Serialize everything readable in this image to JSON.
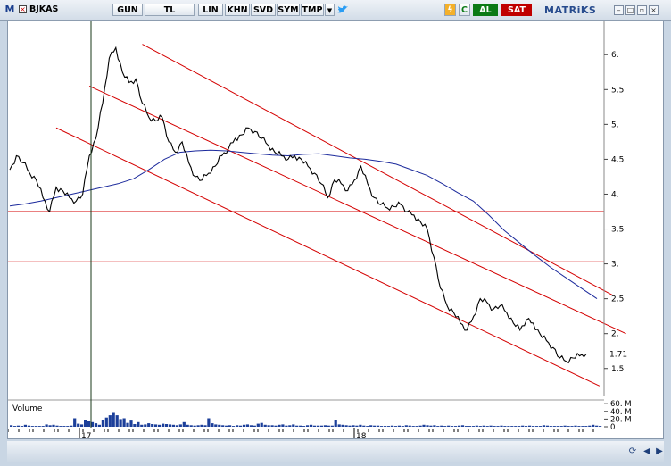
{
  "toolbar": {
    "logo": "M",
    "symbol": "BJKAS",
    "period": "GUN",
    "currency": "TL",
    "scale": "LIN",
    "buttons": [
      "KHN",
      "SVD",
      "SYM",
      "TMP"
    ],
    "quick_letter": "C",
    "buy_label": "AL",
    "sell_label": "SAT",
    "brand": "MATRiKS"
  },
  "colors": {
    "price": "#000000",
    "channel": "#d40000",
    "support": "#d40000",
    "moving_average": "#1c2a9c",
    "volume": "#1c3f9a",
    "buy": "#0b7a16",
    "sell": "#c00000"
  },
  "chart_data": {
    "type": "line",
    "symbol": "BJKAS",
    "y_ticks": [
      "6.",
      "5.5",
      "5.",
      "4.5",
      "4.",
      "3.5",
      "3.",
      "2.5",
      "2.",
      "1.5"
    ],
    "ylim": [
      1.1,
      6.4
    ],
    "last_price_label": "1.71",
    "x_ticks": [
      "17",
      "18"
    ],
    "horizontal_levels": [
      3.75,
      3.03
    ],
    "series": [
      {
        "type": "price",
        "values": [
          4.35,
          4.55,
          4.45,
          4.3,
          4.2,
          3.95,
          3.75,
          4.1,
          4.05,
          3.95,
          3.9,
          4.0,
          4.55,
          4.8,
          5.3,
          5.95,
          6.1,
          5.75,
          5.6,
          5.65,
          5.3,
          5.1,
          5.05,
          5.1,
          4.75,
          4.6,
          4.75,
          4.45,
          4.25,
          4.2,
          4.3,
          4.4,
          4.55,
          4.65,
          4.8,
          4.85,
          4.95,
          4.9,
          4.8,
          4.7,
          4.6,
          4.55,
          4.5,
          4.55,
          4.5,
          4.4,
          4.3,
          4.15,
          3.95,
          4.2,
          4.15,
          4.05,
          4.2,
          4.4,
          4.15,
          3.95,
          3.85,
          3.8,
          3.82,
          3.85,
          3.75,
          3.7,
          3.6,
          3.5,
          3.1,
          2.65,
          2.4,
          2.3,
          2.15,
          2.05,
          2.25,
          2.5,
          2.45,
          2.35,
          2.4,
          2.3,
          2.15,
          2.05,
          2.2,
          2.15,
          2.0,
          1.9,
          1.8,
          1.65,
          1.6,
          1.65,
          1.68,
          1.71
        ]
      },
      {
        "type": "moving-average",
        "values": [
          3.83,
          3.86,
          3.9,
          3.95,
          4.0,
          4.05,
          4.1,
          4.15,
          4.22,
          4.35,
          4.5,
          4.6,
          4.62,
          4.63,
          4.62,
          4.6,
          4.58,
          4.56,
          4.55,
          4.57,
          4.58,
          4.55,
          4.52,
          4.5,
          4.47,
          4.43,
          4.35,
          4.27,
          4.15,
          4.02,
          3.9,
          3.7,
          3.48,
          3.3,
          3.12,
          2.95,
          2.8,
          2.65,
          2.5
        ]
      }
    ],
    "channel": {
      "upper": {
        "start": [
          20,
          6.15
        ],
        "end": [
          91,
          2.55
        ]
      },
      "middle": {
        "start": [
          12,
          5.55
        ],
        "end": [
          93,
          2.0
        ]
      },
      "lower": {
        "start": [
          7,
          4.95
        ],
        "end": [
          89,
          1.25
        ]
      }
    },
    "volume_panel": {
      "label": "Volume",
      "y_ticks": [
        "60. M",
        "40. M",
        "20. M",
        "0"
      ],
      "ylim": [
        0,
        65
      ],
      "values": [
        4,
        2,
        3,
        2,
        5,
        3,
        2,
        2,
        2,
        2,
        6,
        4,
        5,
        3,
        2,
        2,
        2,
        3,
        22,
        8,
        6,
        18,
        14,
        12,
        9,
        5,
        18,
        24,
        30,
        36,
        30,
        20,
        22,
        10,
        16,
        7,
        12,
        5,
        6,
        9,
        7,
        6,
        5,
        8,
        7,
        6,
        5,
        4,
        6,
        12,
        5,
        4,
        3,
        4,
        5,
        4,
        22,
        9,
        6,
        5,
        4,
        3,
        4,
        2,
        4,
        3,
        5,
        6,
        4,
        3,
        8,
        10,
        5,
        4,
        4,
        3,
        5,
        6,
        3,
        4,
        6,
        3,
        3,
        2,
        4,
        5,
        3,
        3,
        3,
        4,
        3,
        3,
        18,
        6,
        5,
        4,
        3,
        4,
        3,
        5,
        3,
        2,
        4,
        3,
        3,
        2,
        2,
        2,
        3,
        2,
        3,
        2,
        4,
        3,
        2,
        2,
        3,
        5,
        4,
        3,
        4,
        2,
        3,
        2,
        3,
        2,
        2,
        3,
        4,
        2,
        2,
        2,
        3,
        2,
        3,
        2,
        3,
        2,
        2,
        3,
        2,
        2,
        2,
        2,
        2,
        3,
        2,
        3,
        2,
        2,
        2,
        4,
        3,
        2,
        2,
        2,
        2,
        3,
        2,
        2,
        3,
        2,
        2,
        2,
        3,
        5,
        3,
        2
      ]
    }
  }
}
